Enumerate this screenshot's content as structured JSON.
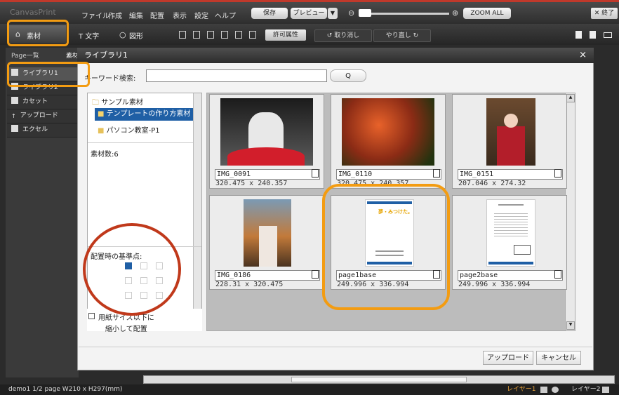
{
  "menubar": {
    "logo": "CanvasPrint",
    "items": [
      "ファイル",
      "作成",
      "編集",
      "配置",
      "表示",
      "設定",
      "ヘルプ"
    ],
    "save_label": "保存",
    "preview_label": "プレビュー",
    "zoom_all_label": "ZOOM ALL",
    "exit_label": "終了"
  },
  "toolbar": {
    "material_label": "素材",
    "text_label": "T 文字",
    "shape_label": "図形",
    "permission_label": "許可属性",
    "undo_label": "取り消し",
    "redo_label": "やり直し"
  },
  "leftpanel": {
    "tab_pages": "Page一覧",
    "tab_materials": "素材",
    "items": [
      "ライブラリ1",
      "ライブラリ2",
      "カセット",
      "アップロード",
      "エクセル"
    ]
  },
  "dialog": {
    "title": "ライブラリ1",
    "close": "×",
    "search_label": "キーワード検索:",
    "search_value": "",
    "search_button": "Q",
    "folders": [
      "サンプル素材",
      "テンプレートの作り方素材",
      "パソコン教室-P1"
    ],
    "count_label": "素材数:6",
    "anchor_label": "配置時の基準点:",
    "fit_checkbox_line1": "用紙サイズ以下に",
    "fit_checkbox_line2": "縮小して配置",
    "upload_button": "アップロード",
    "cancel_button": "キャンセル",
    "thumb_title": "夢・みつけた。",
    "items": [
      {
        "name": "IMG_0091",
        "dims": "320.475 x 240.357"
      },
      {
        "name": "IMG_0110",
        "dims": "320.475 x 240.357"
      },
      {
        "name": "IMG_0151",
        "dims": "207.046 x 274.32"
      },
      {
        "name": "IMG_0186",
        "dims": "228.31 x 320.475"
      },
      {
        "name": "page1base",
        "dims": "249.996 x 336.994"
      },
      {
        "name": "page2base",
        "dims": "249.996 x 336.994"
      }
    ]
  },
  "status": {
    "left": "demo1  1/2 page W210 x H297(mm)",
    "layer1": "レイヤー1",
    "layer2": "レイヤー2"
  },
  "colors": {
    "accent_orange": "#f39c12",
    "circle_red": "#c0391b",
    "selected_blue": "#1f5fa5"
  }
}
